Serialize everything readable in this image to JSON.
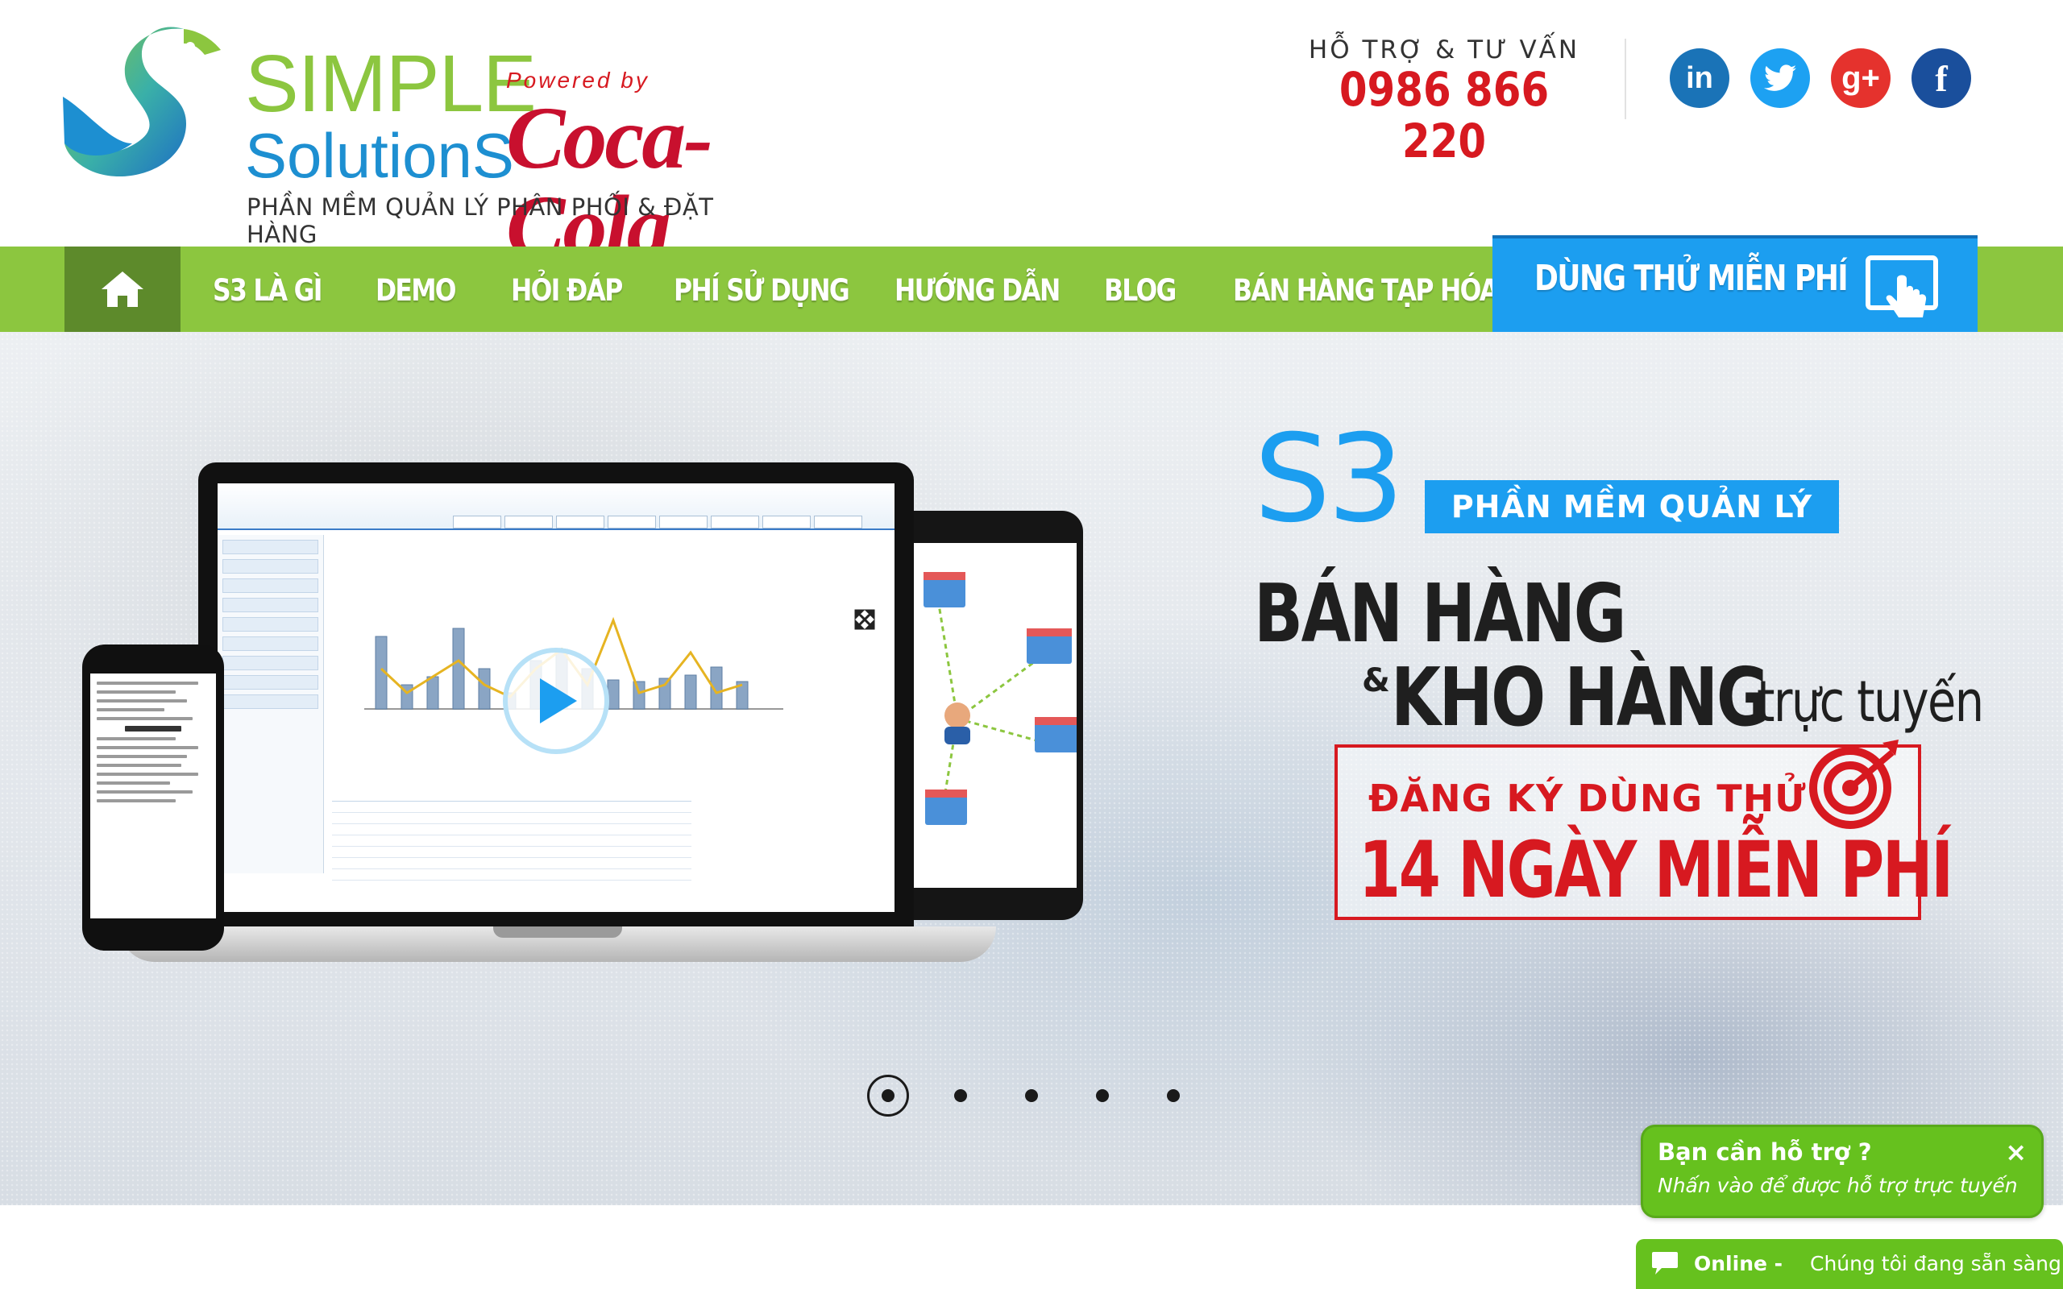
{
  "brand": {
    "logo_line1": "SIMPLE",
    "logo_line2": "SolutionS",
    "powered_by": "Powered by",
    "partner": "Coca-Cola",
    "tagline": "PHẦN MỀM QUẢN LÝ PHÂN PHỐI & ĐẶT HÀNG"
  },
  "support": {
    "label": "HỖ TRỢ & TƯ VẤN",
    "phone": "0986 866 220"
  },
  "social": [
    {
      "name": "linkedin",
      "glyph": "in",
      "color": "#1a73b7"
    },
    {
      "name": "twitter",
      "glyph": "",
      "color": "#1da1f2"
    },
    {
      "name": "google-plus",
      "glyph": "g+",
      "color": "#e5322d"
    },
    {
      "name": "facebook",
      "glyph": "f",
      "color": "#1a4f9c"
    }
  ],
  "nav": {
    "home_icon": "home-icon",
    "items": [
      "S3 LÀ GÌ",
      "DEMO",
      "HỎI ĐÁP",
      "PHÍ SỬ DỤNG",
      "HƯỚNG DẪN",
      "BLOG",
      "BÁN HÀNG TẠP HÓA"
    ],
    "cta_label": "DÙNG THỬ MIỄN PHÍ",
    "cta_icon": "touch-screen-icon",
    "colors": {
      "bar": "#8cc63f",
      "home": "#5d8a2b",
      "cta": "#1c9ef0"
    }
  },
  "hero": {
    "product": "S3",
    "badge": "PHẦN MỀM QUẢN LÝ",
    "line1": "BÁN HÀNG",
    "amp": "&",
    "line2_bold": "KHO HÀNG",
    "line2_light": "trực tuyến",
    "box_line1": "ĐĂNG KÝ DÙNG THỬ",
    "box_line2": "14 NGÀY MIỄN PHÍ",
    "play_icon": "play-icon",
    "target_icon": "target-icon",
    "slides": 5,
    "active_slide": 1
  },
  "chat": {
    "popup_title": "Bạn cần hỗ trợ ?",
    "popup_subtitle": "Nhấn vào để được hỗ trợ trực tuyến",
    "close": "×",
    "status": "Online -",
    "status_text": "Chúng tôi đang sẵn sàng"
  },
  "colors": {
    "green": "#8cc63f",
    "blue": "#1c9ef0",
    "red": "#d71920",
    "chat_green": "#66c11e"
  }
}
